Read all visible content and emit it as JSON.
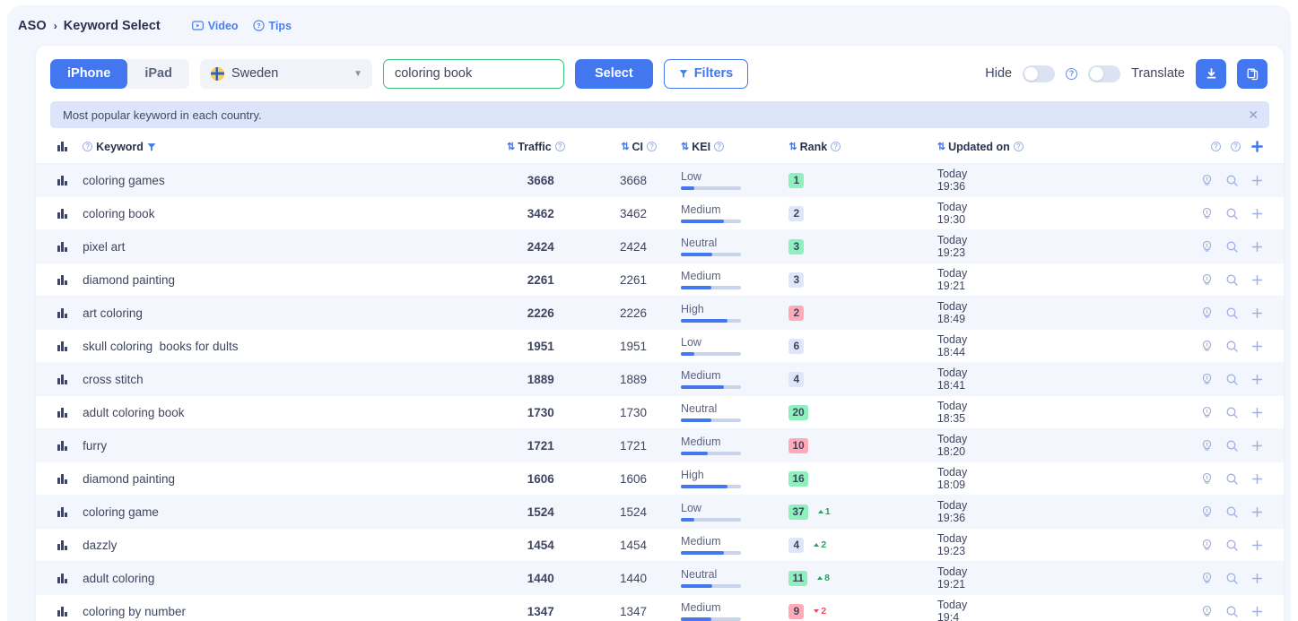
{
  "breadcrumb": {
    "root": "ASO",
    "separator": "›",
    "current": "Keyword Select",
    "links": [
      {
        "label": "Video",
        "icon": "video-icon"
      },
      {
        "label": "Tips",
        "icon": "help-circle-icon"
      }
    ]
  },
  "toolbar": {
    "devices": [
      {
        "label": "iPhone",
        "active": true
      },
      {
        "label": "iPad",
        "active": false
      }
    ],
    "country": {
      "value": "Sweden",
      "flag": "sweden-flag-icon",
      "chevron": "chevron-down-icon"
    },
    "search": {
      "value": "coloring book",
      "placeholder": ""
    },
    "select_label": "Select",
    "filters_label": "Filters",
    "hide_label": "Hide",
    "translate_label": "Translate",
    "hide_toggle_on": false,
    "translate_toggle_on": false,
    "download_icon": "download-icon",
    "copy_icon": "copy-icon",
    "accent_color": "#4277f0",
    "input_border_color": "#35c37d"
  },
  "notice": {
    "text": "Most popular keyword in each country.",
    "close_icon": "close-icon"
  },
  "table": {
    "columns": [
      {
        "key": "bars",
        "label": ""
      },
      {
        "key": "keyword",
        "label": "Keyword",
        "sortable": false,
        "info": true,
        "filter": true
      },
      {
        "key": "traffic",
        "label": "Traffic",
        "sortable": true,
        "info": true
      },
      {
        "key": "ci",
        "label": "CI",
        "sortable": true,
        "info": true
      },
      {
        "key": "kei",
        "label": "KEI",
        "sortable": true,
        "info": true
      },
      {
        "key": "rank",
        "label": "Rank",
        "sortable": true,
        "info": true
      },
      {
        "key": "updated",
        "label": "Updated on",
        "sortable": true,
        "info": true
      }
    ],
    "header_actions": [
      "help-circle-icon",
      "help-circle-icon",
      "plus-icon"
    ],
    "row_actions": [
      "lightbulb-icon",
      "search-icon",
      "plus-icon"
    ],
    "rows": [
      {
        "keyword": "coloring games",
        "traffic": "3668",
        "ci": "3668",
        "kei_label": "Low",
        "kei_pct": 22,
        "rank": "1",
        "rank_color": "green",
        "delta": null,
        "updated_day": "Today",
        "updated_time": "19:36"
      },
      {
        "keyword": "coloring book",
        "traffic": "3462",
        "ci": "3462",
        "kei_label": "Medium",
        "kei_pct": 72,
        "rank": "2",
        "rank_color": "blue",
        "delta": null,
        "updated_day": "Today",
        "updated_time": "19:30"
      },
      {
        "keyword": "pixel art",
        "traffic": "2424",
        "ci": "2424",
        "kei_label": "Neutral",
        "kei_pct": 52,
        "rank": "3",
        "rank_color": "green",
        "delta": null,
        "updated_day": "Today",
        "updated_time": "19:23"
      },
      {
        "keyword": "diamond painting",
        "traffic": "2261",
        "ci": "2261",
        "kei_label": "Medium",
        "kei_pct": 50,
        "rank": "3",
        "rank_color": "blue",
        "delta": null,
        "updated_day": "Today",
        "updated_time": "19:21"
      },
      {
        "keyword": "art coloring",
        "traffic": "2226",
        "ci": "2226",
        "kei_label": "High",
        "kei_pct": 78,
        "rank": "2",
        "rank_color": "red",
        "delta": null,
        "updated_day": "Today",
        "updated_time": "18:49"
      },
      {
        "keyword": "skull coloring  books for dults",
        "traffic": "1951",
        "ci": "1951",
        "kei_label": "Low",
        "kei_pct": 22,
        "rank": "6",
        "rank_color": "blue",
        "delta": null,
        "updated_day": "Today",
        "updated_time": "18:44"
      },
      {
        "keyword": "cross stitch",
        "traffic": "1889",
        "ci": "1889",
        "kei_label": "Medium",
        "kei_pct": 72,
        "rank": "4",
        "rank_color": "blue",
        "delta": null,
        "updated_day": "Today",
        "updated_time": "18:41"
      },
      {
        "keyword": "adult coloring book",
        "traffic": "1730",
        "ci": "1730",
        "kei_label": "Neutral",
        "kei_pct": 50,
        "rank": "20",
        "rank_color": "green",
        "delta": null,
        "updated_day": "Today",
        "updated_time": "18:35"
      },
      {
        "keyword": "furry",
        "traffic": "1721",
        "ci": "1721",
        "kei_label": "Medium",
        "kei_pct": 44,
        "rank": "10",
        "rank_color": "red",
        "delta": null,
        "updated_day": "Today",
        "updated_time": "18:20"
      },
      {
        "keyword": "diamond painting",
        "traffic": "1606",
        "ci": "1606",
        "kei_label": "High",
        "kei_pct": 78,
        "rank": "16",
        "rank_color": "green",
        "delta": null,
        "updated_day": "Today",
        "updated_time": "18:09"
      },
      {
        "keyword": "coloring game",
        "traffic": "1524",
        "ci": "1524",
        "kei_label": "Low",
        "kei_pct": 22,
        "rank": "37",
        "rank_color": "green",
        "delta": {
          "dir": "up",
          "value": "1"
        },
        "updated_day": "Today",
        "updated_time": "19:36"
      },
      {
        "keyword": "dazzly",
        "traffic": "1454",
        "ci": "1454",
        "kei_label": "Medium",
        "kei_pct": 72,
        "rank": "4",
        "rank_color": "blue",
        "delta": {
          "dir": "up",
          "value": "2"
        },
        "updated_day": "Today",
        "updated_time": "19:23"
      },
      {
        "keyword": "adult coloring",
        "traffic": "1440",
        "ci": "1440",
        "kei_label": "Neutral",
        "kei_pct": 52,
        "rank": "11",
        "rank_color": "green",
        "delta": {
          "dir": "up",
          "value": "8"
        },
        "updated_day": "Today",
        "updated_time": "19:21"
      },
      {
        "keyword": "coloring by number",
        "traffic": "1347",
        "ci": "1347",
        "kei_label": "Medium",
        "kei_pct": 50,
        "rank": "9",
        "rank_color": "red",
        "delta": {
          "dir": "down",
          "value": "2"
        },
        "updated_day": "Today",
        "updated_time": "19:4"
      }
    ]
  }
}
